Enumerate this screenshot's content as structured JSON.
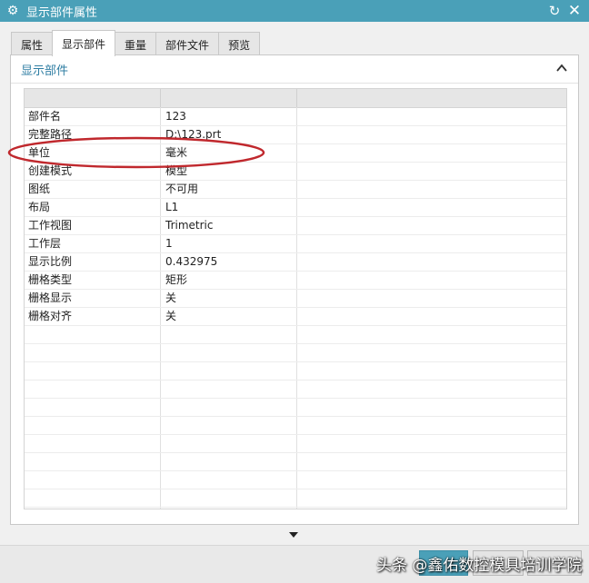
{
  "window": {
    "title": "显示部件属性",
    "icons": {
      "settings": "gear-icon",
      "reset": "reset-icon",
      "close": "close-icon"
    }
  },
  "tabs": [
    {
      "label": "属性"
    },
    {
      "label": "显示部件"
    },
    {
      "label": "重量"
    },
    {
      "label": "部件文件"
    },
    {
      "label": "预览"
    }
  ],
  "group": {
    "title": "显示部件"
  },
  "table": {
    "rows": [
      {
        "name": "部件名",
        "value": "123"
      },
      {
        "name": "完整路径",
        "value": "D:\\123.prt"
      },
      {
        "name": "单位",
        "value": "毫米"
      },
      {
        "name": "创建模式",
        "value": "模型"
      },
      {
        "name": "图纸",
        "value": "不可用"
      },
      {
        "name": "布局",
        "value": "L1"
      },
      {
        "name": "工作视图",
        "value": "Trimetric"
      },
      {
        "name": "工作层",
        "value": "1"
      },
      {
        "name": "显示比例",
        "value": "0.432975"
      },
      {
        "name": "栅格类型",
        "value": "矩形"
      },
      {
        "name": "栅格显示",
        "value": "关"
      },
      {
        "name": "栅格对齐",
        "value": "关"
      }
    ]
  },
  "annotation": {
    "color": "#c0282d"
  },
  "watermark": {
    "text": "头条 @鑫佑数控模具培训学院"
  },
  "colors": {
    "accent": "#4aa0b8",
    "group_title": "#2f7ea3"
  }
}
